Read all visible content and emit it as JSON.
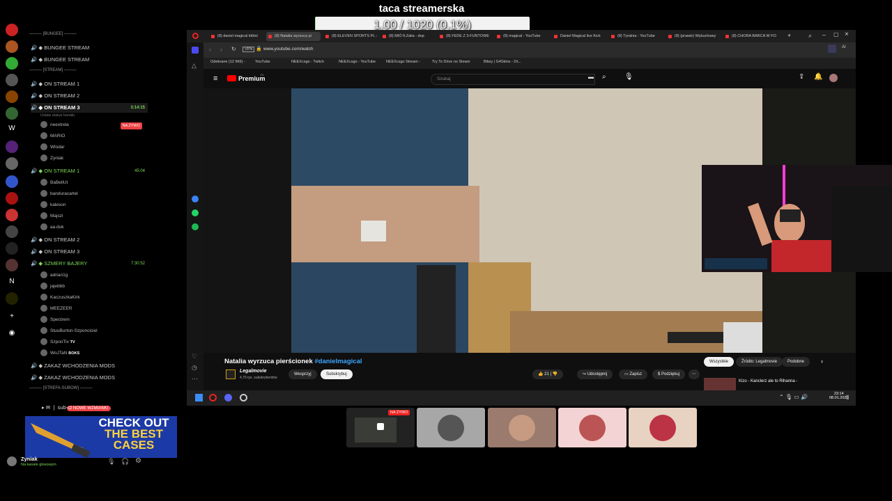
{
  "goal": {
    "title": "taca streamerska",
    "progress_text": "1.00 / 1020 (0.1%)",
    "progress_fraction": 0.001
  },
  "discord": {
    "servers": [
      "W",
      "Z",
      "N"
    ],
    "channels": [
      {
        "kind": "cat",
        "label": "BUNGEE"
      },
      {
        "kind": "ch",
        "label": "BUNGEE STREAM"
      },
      {
        "kind": "ch",
        "label": "BUNGEE STREAM"
      },
      {
        "kind": "cat",
        "label": "STREAM"
      },
      {
        "kind": "ch",
        "label": "ON STREAM 1"
      },
      {
        "kind": "ch",
        "label": "ON STREAM 2"
      },
      {
        "kind": "ch-active",
        "label": "ON STREAM 3",
        "time": "3:14:15",
        "status": "Ustaw status kanału"
      },
      {
        "kind": "ch-green",
        "label": "ON STREAM 1",
        "time": "45:04"
      },
      {
        "kind": "ch",
        "label": "ON STREAM 2"
      },
      {
        "kind": "ch",
        "label": "ON STREAM 3"
      },
      {
        "kind": "ch-green",
        "label": "SZMERY BAJERY",
        "time": "7:30:52"
      },
      {
        "kind": "ch",
        "label": "ZAKAZ WCHODZENIA MODS"
      },
      {
        "kind": "ch",
        "label": "ZAKAZ WCHODZENIA MODS"
      },
      {
        "kind": "cat",
        "label": "STREFA-SUBOW"
      }
    ],
    "members_stream3": [
      "neextrela",
      "MARIO",
      "Wlodar",
      "Zyniak"
    ],
    "live_badge": "NA ŻYWO",
    "members_stream1": [
      "BaBeliUt",
      "banduracartel",
      "kaleson",
      "Majszi",
      "aa.duk"
    ],
    "members_szmery": [
      "adrian1g",
      "jajebbb",
      "KaczuszkaKirk",
      "MEEZEER",
      "Spectrem",
      "StuuBurton-Szponciciel",
      "SzponTix",
      "WoJTaN"
    ],
    "member_tags": {
      "tv": "TV",
      "boks": "BOKS"
    },
    "sub_channel": "sub-c",
    "mentions_badge": "2 NOWE WZMIANKI",
    "user": {
      "name": "Zyniak",
      "status": "Na kanale głosowym"
    }
  },
  "ad": {
    "line1": "CHECK OUT",
    "line2": "THE BEST",
    "line3": "CASES"
  },
  "browser": {
    "tabs": [
      "(8) daniel magical kłótni",
      "(8) Natalia wyrzuca pi",
      "(8) ELEVEN SPORTS PL -",
      "(8) MIÓ ft.Zalia - dop",
      "(8) FEDE Z 3-FUNTOWE",
      "(8) magical - YouTube",
      "Daniel Magical live Kick",
      "(8) Tyralnia - YouTube",
      "(8) (prawie) Wybuchowy",
      "(8) CHORA BARCA W FO"
    ],
    "url": "www.youtube.com/watch",
    "vpn": "VPN",
    "bookmarks": [
      "Odebrane (12 966) -",
      "YouTube",
      "NEEXcsgo - Twitch",
      "NEEXcsgo - YouTube",
      "NEEXcsgo Stream -",
      "Try To Drive no Steam",
      "Bitwy | G4Skins - Ot..."
    ],
    "yt_logo": "Premium",
    "yt_region": "PL",
    "search_placeholder": "Szukaj",
    "video_title": "Natalia wyrzuca pierścionek",
    "video_hashtag": "#danielmagical",
    "channel_name": "Legalmovie",
    "subs": "4,76 tys. subskrybentów",
    "support_btn": "Wesprzyj",
    "subscribe_btn": "Subskrybuj",
    "likes": "21",
    "share": "Udostępnij",
    "save": "Zapisz",
    "thanks": "Podziękuj",
    "chips": [
      "Wszystkie",
      "Źródło: Legalmovie",
      "Podobne"
    ],
    "rec_title": "Kizo - Kanclerz ale to Rihanna -",
    "clock_time": "23:14",
    "clock_date": "08.01.2026"
  },
  "thumbs": {
    "live_badge": "NA ŻYWO"
  }
}
